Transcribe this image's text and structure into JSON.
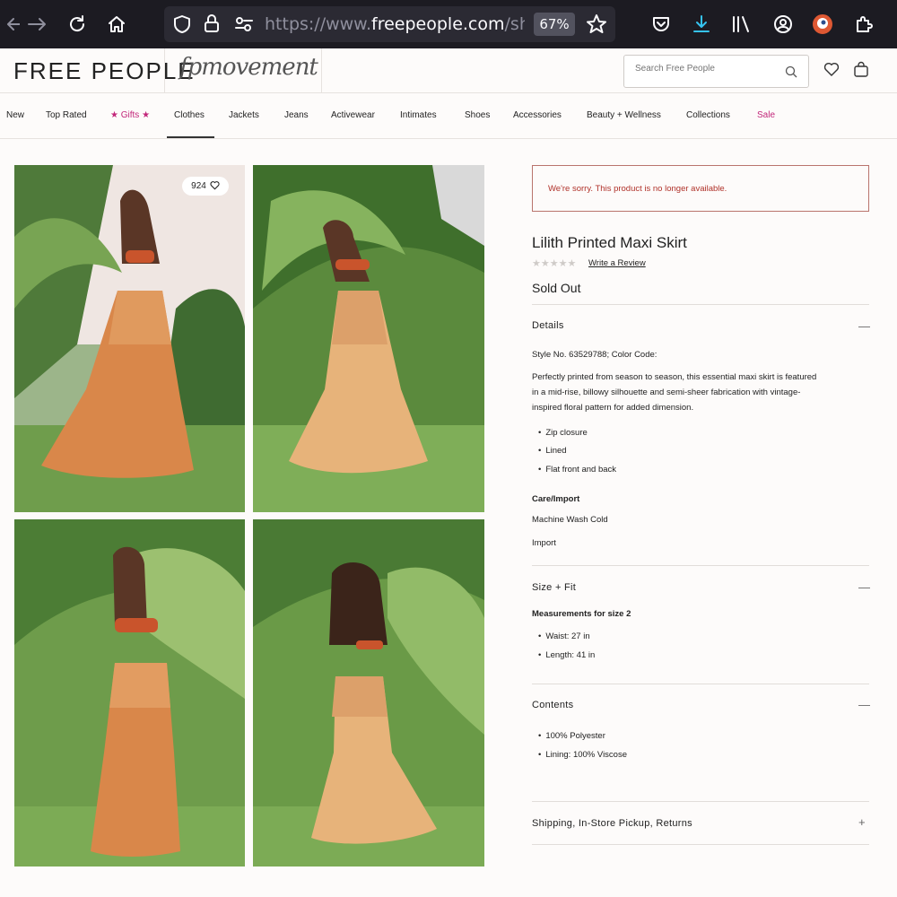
{
  "browser": {
    "url_prefix": "https://www.",
    "url_domain": "freepeople.com",
    "url_rest": "/shop/lili",
    "zoom": "67%"
  },
  "header": {
    "logo": "FREE PEOPLE",
    "script_logo": "fpmovement",
    "search_placeholder": "Search Free People"
  },
  "nav": {
    "items": [
      "New",
      "Top Rated",
      "★ Gifts ★",
      "Clothes",
      "Jackets",
      "Jeans",
      "Activewear",
      "Intimates",
      "Shoes",
      "Accessories",
      "Beauty + Wellness",
      "Collections",
      "Sale"
    ],
    "active": "Clothes"
  },
  "gallery": {
    "likes": "924"
  },
  "product": {
    "alert": "We're sorry. This product is no longer available.",
    "title": "Lilith Printed Maxi Skirt",
    "rating_stars": "★★★★★",
    "rating": 0,
    "write_review": "Write a Review",
    "status": "Sold Out",
    "details": {
      "heading": "Details",
      "toggle": "—",
      "style": "Style No. 63529788; Color Code:",
      "desc_lines": [
        "Perfectly printed from season to season, this essential maxi skirt is featured",
        "in a mid-rise, billowy silhouette and semi-sheer fabrication with vintage-",
        "inspired floral pattern for added dimension."
      ],
      "bullets": [
        "Zip closure",
        "Lined",
        "Flat front and back"
      ],
      "care_heading": "Care/Import",
      "care": [
        "Machine Wash Cold",
        "Import"
      ]
    },
    "size_fit": {
      "heading": "Size + Fit",
      "toggle": "—",
      "subheading": "Measurements for size 2",
      "bullets": [
        "Waist: 27 in",
        "Length: 41 in"
      ]
    },
    "contents": {
      "heading": "Contents",
      "toggle": "—",
      "bullets": [
        "100% Polyester",
        "Lining: 100% Viscose"
      ]
    },
    "shipping": {
      "heading": "Shipping, In-Store Pickup, Returns",
      "toggle": "+"
    }
  },
  "colors": {
    "chrome": "#1c1b22",
    "accent_pink": "#c2267a",
    "alert_text": "#b0322a",
    "skirt": "#d9874a"
  }
}
